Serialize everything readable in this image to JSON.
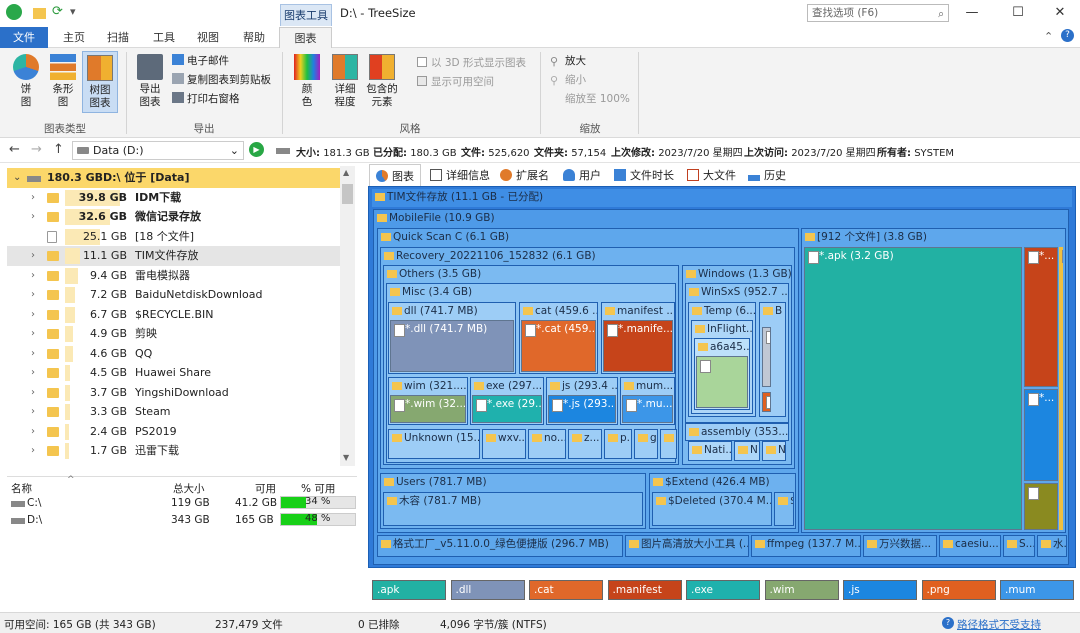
{
  "window": {
    "title": "D:\\ - TreeSize",
    "context_tab": "图表工具",
    "search_placeholder": "查找选项 (F6)"
  },
  "ribbon_tabs": [
    "文件",
    "主页",
    "扫描",
    "工具",
    "视图",
    "帮助",
    "图表"
  ],
  "ribbon": {
    "chart_type_group": "图表类型",
    "pie": "饼\n图",
    "bar": "条形\n图",
    "treemap": "树图\n图表",
    "export_group": "导出",
    "export_chart": "导出\n图表",
    "email": "电子邮件",
    "copy": "复制图表到剪贴板",
    "print": "打印右窗格",
    "style_group": "风格",
    "color": "颜\n色",
    "detail": "详细\n程度",
    "contained": "包含的\n元素",
    "show_3d": "以 3D 形式显示图表",
    "show_free": "显示可用空间",
    "zoom_group": "缩放",
    "zoom_in": "放大",
    "zoom_out": "缩小",
    "zoom_100": "缩放至 100%"
  },
  "addressbar": {
    "drive": "Data (D:)",
    "stats": [
      {
        "label": "大小:",
        "value": "181.3 GB"
      },
      {
        "label": "已分配:",
        "value": "180.3 GB"
      },
      {
        "label": "文件:",
        "value": "525,620"
      },
      {
        "label": "文件夹:",
        "value": "57,154"
      },
      {
        "label": "上次修改:",
        "value": "2023/7/20 星期四"
      },
      {
        "label": "上次访问:",
        "value": "2023/7/20 星期四"
      },
      {
        "label": "所有者:",
        "value": "SYSTEM"
      }
    ]
  },
  "tree": {
    "root": {
      "size": "180.3 GB",
      "name": "D:\\  位于  [Data]"
    },
    "items": [
      {
        "size": "39.8 GB",
        "name": "IDM下载",
        "bold": true,
        "pct": 0.22
      },
      {
        "size": "32.6 GB",
        "name": "微信记录存放",
        "bold": true,
        "pct": 0.18
      },
      {
        "size": "25.1 GB",
        "name": "[18 个文件]",
        "bold": false,
        "pct": 0.14
      },
      {
        "size": "11.1 GB",
        "name": "TIM文件存放",
        "bold": false,
        "pct": 0.06
      },
      {
        "size": "9.4 GB",
        "name": "雷电模拟器",
        "bold": false,
        "pct": 0.05
      },
      {
        "size": "7.2 GB",
        "name": "BaiduNetdiskDownload",
        "bold": false,
        "pct": 0.04
      },
      {
        "size": "6.7 GB",
        "name": "$RECYCLE.BIN",
        "bold": false,
        "pct": 0.04
      },
      {
        "size": "4.9 GB",
        "name": "剪映",
        "bold": false,
        "pct": 0.03
      },
      {
        "size": "4.6 GB",
        "name": "QQ",
        "bold": false,
        "pct": 0.03
      },
      {
        "size": "4.5 GB",
        "name": "Huawei Share",
        "bold": false,
        "pct": 0.02
      },
      {
        "size": "3.7 GB",
        "name": "YingshiDownload",
        "bold": false,
        "pct": 0.02
      },
      {
        "size": "3.3 GB",
        "name": "Steam",
        "bold": false,
        "pct": 0.02
      },
      {
        "size": "2.4 GB",
        "name": "PS2019",
        "bold": false,
        "pct": 0.01
      },
      {
        "size": "1.7 GB",
        "name": "迅雷下载",
        "bold": false,
        "pct": 0.01
      }
    ]
  },
  "drives": {
    "headers": [
      "名称",
      "总大小",
      "可用",
      "% 可用"
    ],
    "rows": [
      {
        "name": "C:\\",
        "total": "119 GB",
        "free": "41.2 GB",
        "pct_label": "34 %",
        "pct": 0.34
      },
      {
        "name": "D:\\",
        "total": "343 GB",
        "free": "165 GB",
        "pct_label": "48 %",
        "pct": 0.48
      }
    ]
  },
  "view_tabs": [
    "图表",
    "详细信息",
    "扩展名",
    "用户",
    "文件时长",
    "大文件",
    "历史"
  ],
  "treemap": {
    "root": "TIM文件存放 (11.1 GB - 已分配)",
    "mobile": "MobileFile (10.9 GB)",
    "quickscan": "Quick Scan C (6.1 GB)",
    "recovery": "Recovery_20221106_152832 (6.1 GB)",
    "others": "Others (3.5 GB)",
    "misc": "Misc (3.4 GB)",
    "dll": "dll (741.7 MB)",
    "dll_leaf": "*.dll (741.7 MB)",
    "cat": "cat (459.6 ...",
    "cat_leaf": "*.cat (459...",
    "manifest": "manifest ...",
    "manifest_leaf": "*.manife...",
    "wim": "wim (321....",
    "wim_leaf": "*.wim (32...",
    "exe": "exe (297....",
    "exe_leaf": "*.exe (29...",
    "js": "js (293.4 ...",
    "js_leaf": "*.js (293....",
    "mum": "mum...",
    "mum_leaf": "*.mu...",
    "unknown": "Unknown (15...",
    "wxv": "wxv...",
    "no": "no...",
    "z": "z...",
    "p": "p..",
    "g": "g",
    "windows": "Windows (1.3 GB)",
    "winsxs": "WinSxS (952.7 ...",
    "temp": "Temp (6...",
    "b": "B",
    "inflight": "InFlight...",
    "a6a45": "a6a45...",
    "assembly": "assembly (353....",
    "nati": "Nati...",
    "n": "N",
    "nn": "N",
    "files912": "[912 个文件] (3.8 GB)",
    "apk_leaf": "*.apk (3.2 GB)",
    "small1": "*...",
    "small2": "*...",
    "users": "Users (781.7 MB)",
    "mujiao": "木容 (781.7 MB)",
    "extend": "$Extend (426.4 MB)",
    "deleted": "$Deleted (370.4 M...",
    "dollar": "$...",
    "geshi": "格式工厂_v5.11.0.0_绿色便捷版 (296.7 MB)",
    "tupian": "图片高清放大小工具 (...",
    "ffmpeg": "ffmpeg (137.7 M...",
    "wanxing": "万兴数据...",
    "caesiu": "caesiu...",
    "s": "S...",
    "shui": "水..."
  },
  "legend": [
    {
      "label": ".apk",
      "color": "#22b1a3"
    },
    {
      "label": ".dll",
      "color": "#7f93b8"
    },
    {
      "label": ".cat",
      "color": "#e0682a"
    },
    {
      "label": ".manifest",
      "color": "#c6441a"
    },
    {
      "label": ".exe",
      "color": "#1fb1ad"
    },
    {
      "label": ".wim",
      "color": "#86a870"
    },
    {
      "label": ".js",
      "color": "#1c86e0"
    },
    {
      "label": ".png",
      "color": "#e06020"
    },
    {
      "label": ".mum",
      "color": "#3c96e8"
    }
  ],
  "status": {
    "free": "可用空间: 165 GB (共 343 GB)",
    "files": "237,479 文件",
    "excluded": "0 已排除",
    "cluster": "4,096 字节/簇 (NTFS)",
    "path_warning": "路径格式不受支持"
  }
}
